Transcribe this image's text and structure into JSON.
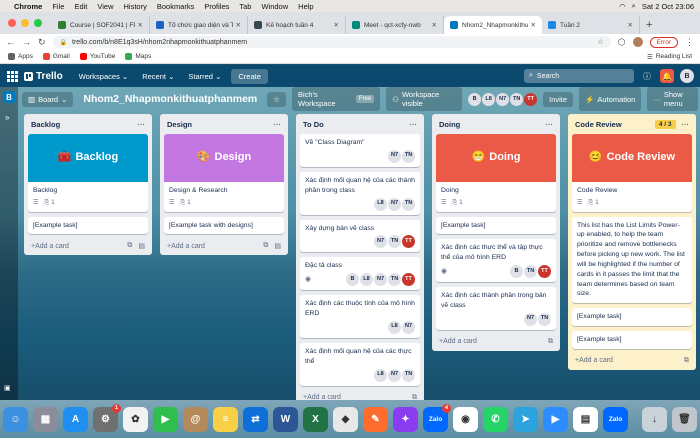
{
  "macbar": {
    "menus": [
      "Chrome",
      "File",
      "Edit",
      "View",
      "History",
      "Bookmarks",
      "Profiles",
      "Tab",
      "Window",
      "Help"
    ],
    "clock": "Sat 2 Oct  23:06"
  },
  "browser": {
    "tabs": [
      {
        "title": "Course | SOF2041 | FPT Poly",
        "color": "#2e7d32"
      },
      {
        "title": "Tổ chức giao diện và Thao tác",
        "color": "#1565c0"
      },
      {
        "title": "Kế hoạch tuần 4",
        "color": "#37474f"
      },
      {
        "title": "Meet - qct-xcfy-nwb",
        "color": "#00897b"
      },
      {
        "title": "Nhom2_Nhapmonkithuatphan",
        "color": "#0079bf"
      },
      {
        "title": "Tuần 2",
        "color": "#1e88e5"
      }
    ],
    "url": "trello.com/b/n8E1q3sH/nhom2nhapmonkithuatphanmem",
    "error_label": "Error",
    "bookmarks": [
      "Apps",
      "Gmail",
      "YouTube",
      "Maps"
    ],
    "reading_list": "Reading List"
  },
  "trello": {
    "logo": "Trello",
    "menus": {
      "workspaces": "Workspaces",
      "recent": "Recent",
      "starred": "Starred",
      "create": "Create"
    },
    "search_placeholder": "Search",
    "user_initial": "B",
    "sidebar_initial": "B"
  },
  "board": {
    "view": "Board",
    "title": "Nhom2_Nhapmonkithuatphanmem",
    "workspace": "Bich's Workspace",
    "workspace_tier": "Free",
    "visibility": "Workspace visible",
    "members": [
      "B",
      "L8",
      "N7",
      "TN",
      "TT"
    ],
    "invite": "Invite",
    "automation": "Automation",
    "show_menu": "Show menu",
    "add_card": "Add a card"
  },
  "lists": {
    "backlog": {
      "title": "Backlog",
      "cover_label": "Backlog",
      "cover_emoji": "🧰",
      "cover_color": "#0099cc",
      "cards": [
        {
          "title": "Backlog",
          "checklist": "1"
        },
        {
          "title": "[Example task]"
        }
      ]
    },
    "design": {
      "title": "Design",
      "cover_label": "Design",
      "cover_emoji": "🎨",
      "cover_color": "#c377e0",
      "cards": [
        {
          "title": "Design & Research",
          "checklist": "1"
        },
        {
          "title": "[Example task with designs]"
        }
      ]
    },
    "todo": {
      "title": "To Do",
      "cards": [
        {
          "title": "Vẽ \"Class Diagram\"",
          "members": [
            "N7",
            "TN"
          ]
        },
        {
          "title": "Xác định mối quan hệ của các thành phần trong class",
          "members": [
            "L8",
            "N7",
            "TN"
          ]
        },
        {
          "title": "Xây dựng bản vẽ class",
          "members": [
            "N7",
            "TN",
            "TT"
          ]
        },
        {
          "title": "Đặc tả class",
          "members": [
            "B",
            "L8",
            "N7",
            "TN",
            "TT"
          ]
        },
        {
          "title": "Xác định các thuộc tính của mô hình ERD",
          "members": [
            "L8",
            "N7"
          ]
        },
        {
          "title": "Xác định mối quan hệ của các thực thể",
          "members": [
            "L8",
            "N7",
            "TN"
          ]
        }
      ]
    },
    "doing": {
      "title": "Doing",
      "cover_label": "Doing",
      "cover_emoji": "😁",
      "cover_color": "#eb5a46",
      "cards": [
        {
          "title": "Doing",
          "checklist": "1"
        },
        {
          "title": "[Example task]"
        },
        {
          "title": "Xác định các thực thể và tập thực thể của mô hình ERD",
          "members": [
            "B",
            "TN",
            "TT"
          ]
        },
        {
          "title": "Xác định các thành phần trong bản vẽ class",
          "members": [
            "N7",
            "TN"
          ]
        }
      ]
    },
    "review": {
      "title": "Code Review",
      "limit": "4 / 3",
      "cover_label": "Code Review",
      "cover_emoji": "😊",
      "cover_color": "#eb5a46",
      "cards": [
        {
          "title": "Code Review",
          "checklist": "1"
        },
        {
          "title": "This list has the List Limits Power-up enabled, to help the team prioritize and remove bottlenecks before picking up new work. The list will be highlighted if the number of cards in it passes the limit that the team determines based on team size."
        },
        {
          "title": "[Example task]"
        },
        {
          "title": "[Example task]"
        }
      ]
    }
  },
  "dock": {
    "apps": [
      {
        "name": "Finder",
        "color": "#3d8fe0",
        "label": "☺"
      },
      {
        "name": "Launchpad",
        "color": "#8d8d99",
        "label": "▦"
      },
      {
        "name": "App Store",
        "color": "#1e8ef0",
        "label": "A"
      },
      {
        "name": "System Preferences",
        "color": "#707070",
        "label": "⚙",
        "badge": "1"
      },
      {
        "name": "Photos",
        "color": "#f2f2f2",
        "label": "✿"
      },
      {
        "name": "FaceTime",
        "color": "#2fbf4e",
        "label": "▶"
      },
      {
        "name": "Contacts",
        "color": "#b58a5a",
        "label": "@"
      },
      {
        "name": "Notes",
        "color": "#f7d046",
        "label": "≡"
      },
      {
        "name": "TeamViewer",
        "color": "#0e6fd8",
        "label": "⇄"
      },
      {
        "name": "Word",
        "color": "#2b5797",
        "label": "W"
      },
      {
        "name": "Excel",
        "color": "#217346",
        "label": "X"
      },
      {
        "name": "Sublime",
        "color": "#e8e8e8",
        "label": "◆"
      },
      {
        "name": "Draw",
        "color": "#ff6d2e",
        "label": "✎"
      },
      {
        "name": "Messenger",
        "color": "#8a3cf0",
        "label": "✦"
      },
      {
        "name": "Zalo",
        "color": "#0068ff",
        "label": "Zalo",
        "badge": "4"
      },
      {
        "name": "Chrome",
        "color": "#ffffff",
        "label": "◉"
      },
      {
        "name": "WhatsApp",
        "color": "#25d366",
        "label": "✆"
      },
      {
        "name": "Telegram",
        "color": "#2aa3df",
        "label": "➤"
      },
      {
        "name": "Zoom",
        "color": "#2d8cff",
        "label": "▶"
      },
      {
        "name": "Calendar",
        "color": "#ffffff",
        "label": "▤"
      },
      {
        "name": "Zalo 2",
        "color": "#0068ff",
        "label": "Zalo"
      },
      {
        "name": "Downloads",
        "color": "#c9d2d8",
        "label": "↓"
      },
      {
        "name": "Trash",
        "color": "#c0c6cb",
        "label": "🗑"
      }
    ]
  }
}
